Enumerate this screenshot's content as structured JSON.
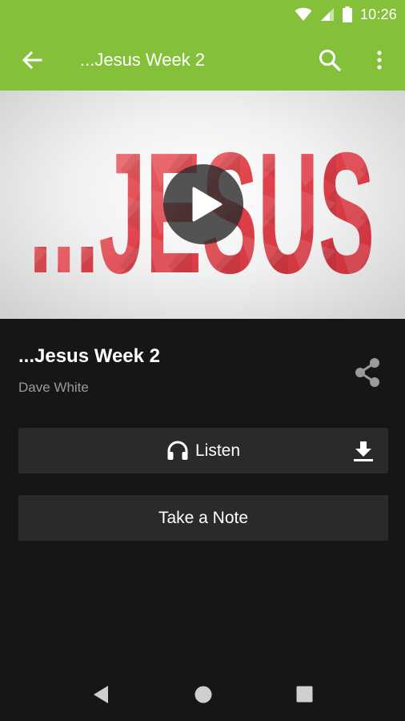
{
  "status": {
    "time": "10:26"
  },
  "appbar": {
    "title": "...Jesus Week 2"
  },
  "hero": {
    "art_text": "...JESUS"
  },
  "sermon": {
    "title": "...Jesus Week 2",
    "speaker": "Dave White"
  },
  "actions": {
    "listen_label": "Listen",
    "note_label": "Take a Note"
  },
  "colors": {
    "accent": "#84c03a",
    "background": "#151618",
    "button": "#2a2a2c",
    "art_red": "#e0424b"
  },
  "icons": [
    "wifi-icon",
    "cell-signal-icon",
    "battery-icon",
    "back-arrow-icon",
    "search-icon",
    "more-vert-icon",
    "play-icon",
    "share-icon",
    "headphones-icon",
    "download-icon",
    "nav-back-icon",
    "nav-home-icon",
    "nav-recents-icon"
  ]
}
